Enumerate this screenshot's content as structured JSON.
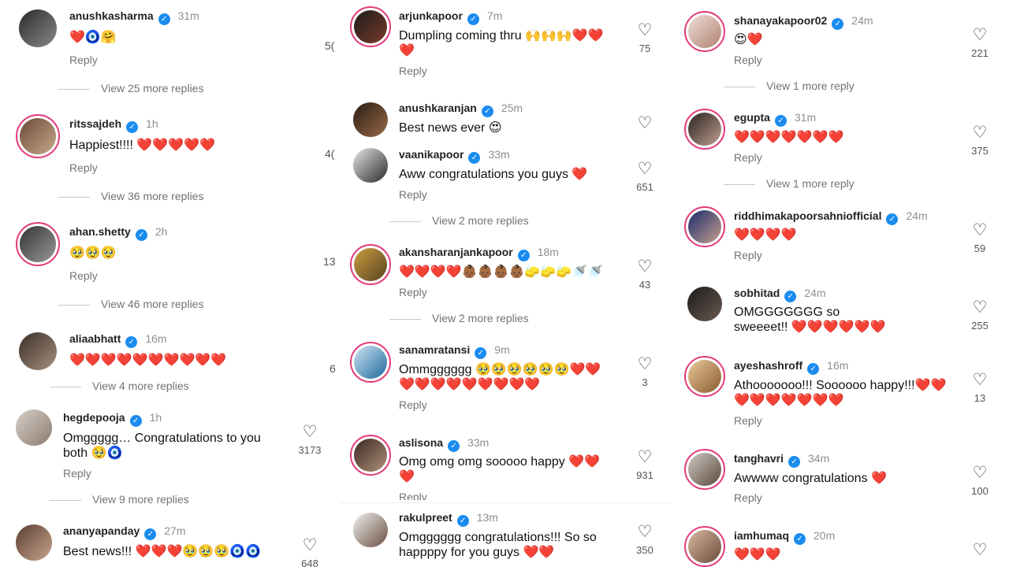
{
  "ui": {
    "reply_label": "Reply",
    "heart_glyph": "♡",
    "verified_glyph": "✓",
    "accent": "#1a8cf0",
    "ring": "#e23a7a"
  },
  "col1": {
    "comments": [
      {
        "user": "anushkasharma",
        "time": "31m",
        "text": "❤️🧿🤗",
        "likes": ""
      },
      {
        "user": "ritssajdeh",
        "time": "1h",
        "text": "Happiest!!!! ❤️❤️❤️❤️❤️",
        "likes": ""
      },
      {
        "user": "ahan.shetty",
        "time": "2h",
        "text": "🥹🥹🥹",
        "likes": ""
      },
      {
        "user": "aliaabhatt",
        "time": "16m",
        "text": "❤️❤️❤️❤️❤️❤️❤️❤️❤️❤️",
        "likes": ""
      },
      {
        "user": "hegdepooja",
        "time": "1h",
        "text": "Omggggg… Congratulations to you both 🥹🧿",
        "likes": "3173"
      },
      {
        "user": "ananyapanday",
        "time": "27m",
        "text": "Best news!!! ❤️❤️❤️🥹🥹🥹🧿🧿",
        "likes": "648"
      }
    ],
    "view_more": [
      "View 25 more replies",
      "View 36 more replies",
      "View 46 more replies",
      "View 4 more replies",
      "View 9 more replies"
    ],
    "edge_fragments": [
      "5(",
      "4(",
      "13",
      "6"
    ]
  },
  "col2": {
    "comments": [
      {
        "user": "arjunkapoor",
        "time": "7m",
        "text": "Dumpling coming thru 🙌🙌🙌❤️❤️❤️",
        "likes": "75"
      },
      {
        "user": "anushkaranjan",
        "time": "25m",
        "text": "Best news ever 😍",
        "likes": ""
      },
      {
        "user": "vaanikapoor",
        "time": "33m",
        "text": "Aww congratulations you guys ❤️",
        "likes": "651"
      },
      {
        "user": "akansharanjankapoor",
        "time": "18m",
        "text": "❤️❤️❤️❤️👶🏾👶🏾👶🏾👶🏾🧽🧽🧽🚿🚿",
        "likes": "43"
      },
      {
        "user": "sanamratansi",
        "time": "9m",
        "text": "Ommgggggg 🥹🥹🥹🥹🥹🥹❤️❤️❤️❤️❤️❤️❤️❤️❤️❤️❤️",
        "likes": "3"
      },
      {
        "user": "aslisona",
        "time": "33m",
        "text": "Omg omg omg sooooo happy ❤️❤️❤️",
        "likes": "931"
      },
      {
        "user": "rakulpreet",
        "time": "13m",
        "text": "Omgggggg congratulations!!! So so happppy for you guys ❤️❤️",
        "likes": "350"
      }
    ],
    "view_more": [
      "View 2 more replies",
      "View 2 more replies"
    ]
  },
  "col3": {
    "comments": [
      {
        "user": "shanayakapoor02",
        "time": "24m",
        "text": "😍❤️",
        "likes": "221"
      },
      {
        "user": "egupta",
        "time": "31m",
        "text": "❤️❤️❤️❤️❤️❤️❤️",
        "likes": "375"
      },
      {
        "user": "riddhimakapoorsahniofficial",
        "time": "24m",
        "text": "❤️❤️❤️❤️",
        "likes": "59"
      },
      {
        "user": "sobhitad",
        "time": "24m",
        "text": "OMGGGGGGG so sweeeet!! ❤️❤️❤️❤️❤️❤️",
        "likes": "255"
      },
      {
        "user": "ayeshashroff",
        "time": "16m",
        "text": "Athooooooo!!! Soooooo happy!!!❤️❤️❤️❤️❤️❤️❤️❤️❤️",
        "likes": "13"
      },
      {
        "user": "tanghavri",
        "time": "34m",
        "text": "Awwww congratulations ❤️",
        "likes": "100"
      },
      {
        "user": "iamhumaq",
        "time": "20m",
        "text": "❤️❤️❤️",
        "likes": ""
      }
    ],
    "view_more": [
      "View 1 more reply",
      "View 1 more reply"
    ]
  }
}
